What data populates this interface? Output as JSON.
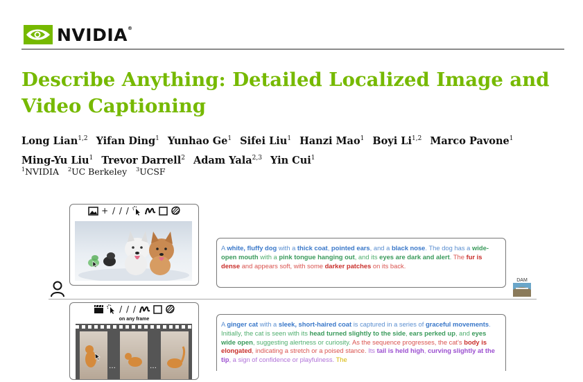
{
  "logo": {
    "text": "NVIDIA",
    "tm": "®",
    "color": "#76b900"
  },
  "title": "Describe Anything: Detailed Localized Image and Video Captioning",
  "authors": [
    {
      "name": "Long Lian",
      "sup": "1,2"
    },
    {
      "name": "Yifan Ding",
      "sup": "1"
    },
    {
      "name": "Yunhao Ge",
      "sup": "1"
    },
    {
      "name": "Sifei Liu",
      "sup": "1"
    },
    {
      "name": "Hanzi Mao",
      "sup": "1"
    },
    {
      "name": "Boyi Li",
      "sup": "1,2"
    },
    {
      "name": "Marco Pavone",
      "sup": "1"
    },
    {
      "name": "Ming-Yu Liu",
      "sup": "1"
    },
    {
      "name": "Trevor Darrell",
      "sup": "2"
    },
    {
      "name": "Adam Yala",
      "sup": "2,3"
    },
    {
      "name": "Yin Cui",
      "sup": "1"
    }
  ],
  "affiliations": [
    {
      "sup": "1",
      "name": "NVIDIA"
    },
    {
      "sup": "2",
      "name": "UC Berkeley"
    },
    {
      "sup": "3",
      "name": "UCSF"
    }
  ],
  "figure": {
    "image_tools": "+ / / /",
    "video_tools": "/ / /",
    "video_tools_note": "on any frame",
    "dam_badge": "DAM",
    "image_caption": [
      {
        "t": "A ",
        "c": "#5b8fd0"
      },
      {
        "t": "white, fluffy dog",
        "c": "#3a78c9",
        "b": true
      },
      {
        "t": " with a ",
        "c": "#5b8fd0"
      },
      {
        "t": "thick coat",
        "c": "#3a78c9",
        "b": true
      },
      {
        "t": ", ",
        "c": "#5b8fd0"
      },
      {
        "t": "pointed ears",
        "c": "#3a78c9",
        "b": true
      },
      {
        "t": ", and a ",
        "c": "#5b8fd0"
      },
      {
        "t": "black nose",
        "c": "#3a78c9",
        "b": true
      },
      {
        "t": ". The dog has a ",
        "c": "#5b8fd0"
      },
      {
        "t": "wide-open mouth",
        "c": "#3a9a5b",
        "b": true
      },
      {
        "t": " with a ",
        "c": "#4fae6e"
      },
      {
        "t": "pink tongue hanging out",
        "c": "#3a9a5b",
        "b": true
      },
      {
        "t": ", and its ",
        "c": "#4fae6e"
      },
      {
        "t": "eyes are dark and alert",
        "c": "#3a9a5b",
        "b": true
      },
      {
        "t": ". ",
        "c": "#4fae6e"
      },
      {
        "t": "The ",
        "c": "#d9534f"
      },
      {
        "t": "fur is dense",
        "c": "#c9302c",
        "b": true
      },
      {
        "t": " and appears soft, with some ",
        "c": "#d9534f"
      },
      {
        "t": "darker patches",
        "c": "#c9302c",
        "b": true
      },
      {
        "t": " on its back.",
        "c": "#d9534f"
      }
    ],
    "video_caption": [
      {
        "t": "A ",
        "c": "#5b8fd0"
      },
      {
        "t": "ginger cat",
        "c": "#3a78c9",
        "b": true
      },
      {
        "t": " with a ",
        "c": "#5b8fd0"
      },
      {
        "t": "sleek, short-haired coat",
        "c": "#3a78c9",
        "b": true
      },
      {
        "t": " is captured in a series of ",
        "c": "#5b8fd0"
      },
      {
        "t": "graceful movements",
        "c": "#3a78c9",
        "b": true
      },
      {
        "t": ". ",
        "c": "#5b8fd0"
      },
      {
        "t": "Initially, the cat is seen with its ",
        "c": "#4fae6e"
      },
      {
        "t": "head turned slightly to the side",
        "c": "#3a9a5b",
        "b": true
      },
      {
        "t": ", ",
        "c": "#4fae6e"
      },
      {
        "t": "ears perked up",
        "c": "#3a9a5b",
        "b": true
      },
      {
        "t": ", and ",
        "c": "#4fae6e"
      },
      {
        "t": "eyes wide open",
        "c": "#3a9a5b",
        "b": true
      },
      {
        "t": ", suggesting alertness or curiosity. ",
        "c": "#4fae6e"
      },
      {
        "t": "As the sequence progresses, the cat's ",
        "c": "#d9534f"
      },
      {
        "t": "body is elongated",
        "c": "#c9302c",
        "b": true
      },
      {
        "t": ", indicating a stretch or a poised stance. ",
        "c": "#d9534f"
      },
      {
        "t": "Its ",
        "c": "#b072d8"
      },
      {
        "t": "tail is held high",
        "c": "#9b4fd0",
        "b": true
      },
      {
        "t": ", ",
        "c": "#b072d8"
      },
      {
        "t": "curving slightly at the tip",
        "c": "#9b4fd0",
        "b": true
      },
      {
        "t": ", a sign of confidence or playfulness. ",
        "c": "#b072d8"
      },
      {
        "t": "The",
        "c": "#d6b600"
      }
    ]
  }
}
